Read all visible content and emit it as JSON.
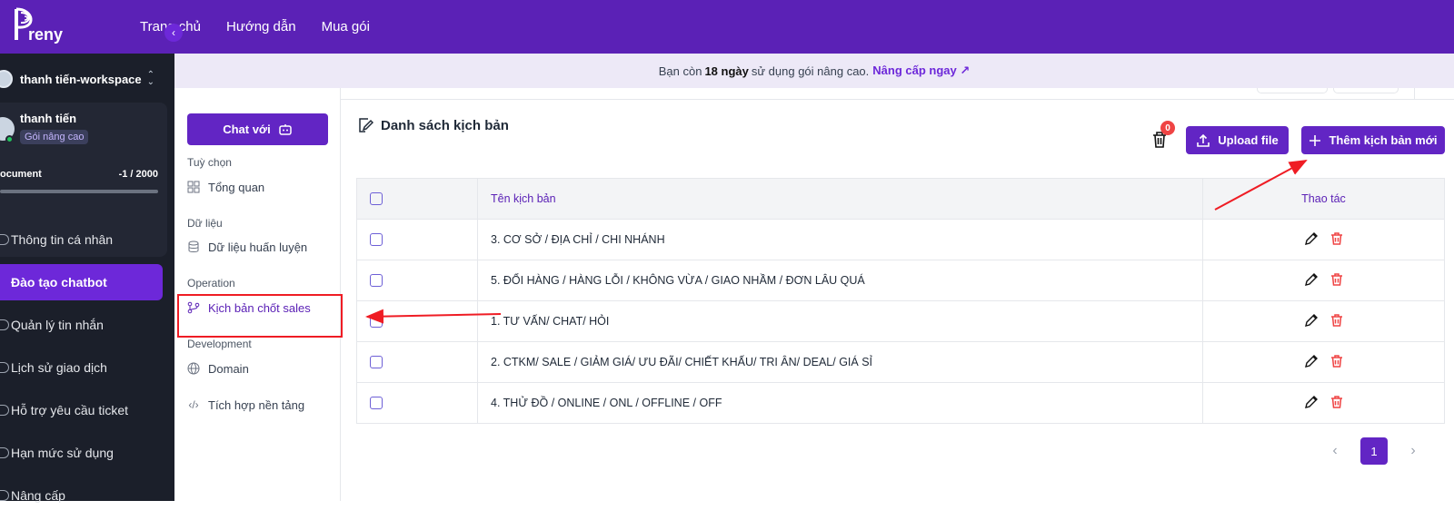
{
  "brand": {
    "logo_text": "reny"
  },
  "nav": {
    "items": [
      "Trang chủ",
      "Hướng dẫn",
      "Mua gói"
    ]
  },
  "banner": {
    "prefix": "Bạn còn",
    "days": "18 ngày",
    "suffix": "sử dụng gói nâng cao.",
    "upgrade": "Nâng cấp ngay ↗"
  },
  "workspace": {
    "name": "thanh tiến-workspace"
  },
  "user": {
    "name": "thanh tiến",
    "plan": "Gói nâng cao",
    "doc_label": "ocument",
    "doc_count": "-1 / 2000"
  },
  "sidebar": {
    "items": [
      {
        "label": "Thông tin cá nhân",
        "active": false
      },
      {
        "label": "Đào tạo chatbot",
        "active": true
      },
      {
        "label": "Quản lý tin nhắn",
        "active": false
      },
      {
        "label": "Lịch sử giao dịch",
        "active": false
      },
      {
        "label": "Hỗ trợ yêu cầu ticket",
        "active": false
      },
      {
        "label": "Hạn mức sử dụng",
        "active": false
      },
      {
        "label": "Nâng cấp",
        "active": false
      }
    ]
  },
  "subnav": {
    "chat_button": "Chat với",
    "sections": {
      "options": "Tuỳ chọn",
      "data": "Dữ liệu",
      "operation": "Operation",
      "development": "Development"
    },
    "items": {
      "overview": "Tổng quan",
      "training": "Dữ liệu huấn luyện",
      "scripts": "Kịch bản chốt sales",
      "domain": "Domain",
      "integration": "Tích hợp nền tảng"
    }
  },
  "page": {
    "title": "Danh sách kịch bản",
    "trash_count": "0",
    "upload_label": "Upload file",
    "add_label": "Thêm kịch bản mới"
  },
  "table": {
    "headers": {
      "name": "Tên kịch bản",
      "actions": "Thao tác"
    },
    "rows": [
      "3. CƠ SỞ / ĐỊA CHỈ / CHI NHÁNH",
      "5. ĐỔI HÀNG / HÀNG LỖI / KHÔNG VỪA / GIAO NHẦM / ĐƠN LÂU QUÁ",
      "1. TƯ VẤN/ CHAT/ HỎI",
      "2. CTKM/ SALE / GIẢM GIÁ/ ƯU ĐÃI/ CHIẾT KHẤU/ TRI ÂN/ DEAL/ GIÁ SỈ",
      "4. THỬ ĐỒ / ONLINE / ONL / OFFLINE / OFF"
    ]
  },
  "pagination": {
    "current": "1"
  },
  "colors": {
    "brand": "#5b21b6",
    "button": "#6225c4",
    "danger": "#ef4444",
    "annotation": "#ef1c24"
  }
}
